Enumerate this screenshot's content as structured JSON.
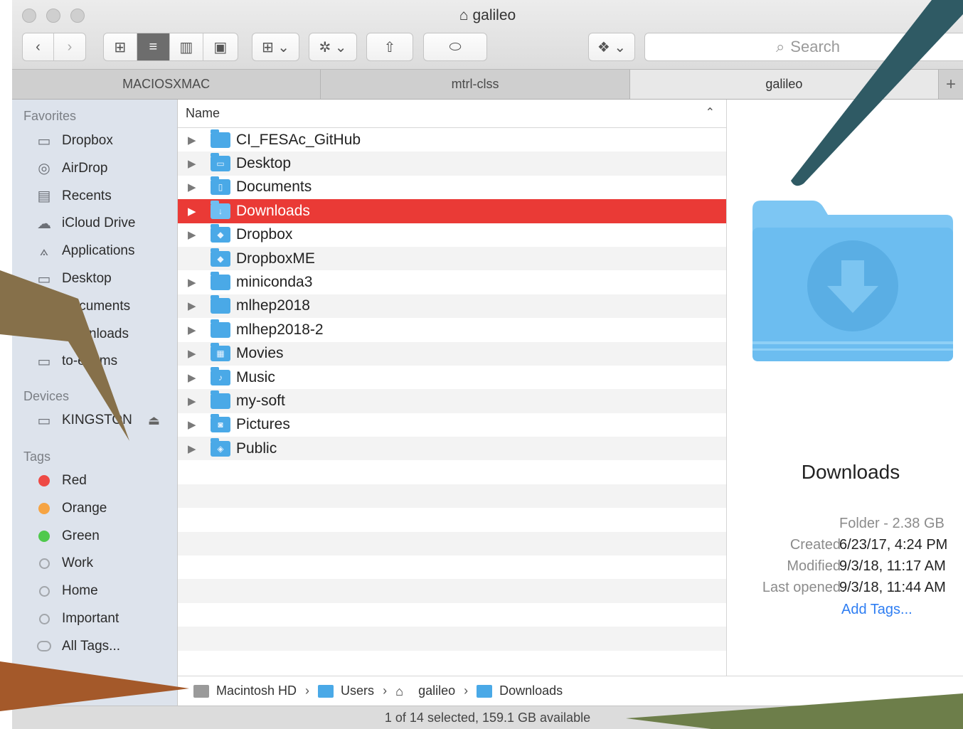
{
  "window": {
    "title": "galileo",
    "tabs": [
      "MACIOSXMAC",
      "mtrl-clss",
      "galileo"
    ],
    "active_tab": 2,
    "search_placeholder": "Search"
  },
  "sidebar": {
    "favorites_label": "Favorites",
    "favorites": [
      {
        "label": "Dropbox",
        "icon": "folder-icon"
      },
      {
        "label": "AirDrop",
        "icon": "airdrop-icon"
      },
      {
        "label": "Recents",
        "icon": "recents-icon"
      },
      {
        "label": "iCloud Drive",
        "icon": "cloud-icon"
      },
      {
        "label": "Applications",
        "icon": "applications-icon"
      },
      {
        "label": "Desktop",
        "icon": "desktop-icon"
      },
      {
        "label": "Documents",
        "icon": "documents-icon"
      },
      {
        "label": "Downloads",
        "icon": "downloads-icon"
      },
      {
        "label": "to-exams",
        "icon": "folder-icon"
      }
    ],
    "devices_label": "Devices",
    "devices": [
      {
        "label": "KINGSTON",
        "icon": "drive-icon"
      }
    ],
    "tags_label": "Tags",
    "tags": [
      {
        "label": "Red",
        "color": "#ee4a45"
      },
      {
        "label": "Orange",
        "color": "#f6a443"
      },
      {
        "label": "Green",
        "color": "#4fc94c"
      },
      {
        "label": "Work",
        "color": ""
      },
      {
        "label": "Home",
        "color": ""
      },
      {
        "label": "Important",
        "color": ""
      },
      {
        "label": "All Tags...",
        "color": "all"
      }
    ]
  },
  "list": {
    "column_header": "Name",
    "rows": [
      {
        "name": "CI_FESAc_GitHub",
        "expandable": true,
        "glyph": ""
      },
      {
        "name": "Desktop",
        "expandable": true,
        "glyph": "▭"
      },
      {
        "name": "Documents",
        "expandable": true,
        "glyph": "▯"
      },
      {
        "name": "Downloads",
        "expandable": true,
        "glyph": "↓"
      },
      {
        "name": "Dropbox",
        "expandable": true,
        "glyph": "◆"
      },
      {
        "name": "DropboxME",
        "expandable": false,
        "glyph": "◆"
      },
      {
        "name": "miniconda3",
        "expandable": true,
        "glyph": ""
      },
      {
        "name": "mlhep2018",
        "expandable": true,
        "glyph": ""
      },
      {
        "name": "mlhep2018-2",
        "expandable": true,
        "glyph": ""
      },
      {
        "name": "Movies",
        "expandable": true,
        "glyph": "▦"
      },
      {
        "name": "Music",
        "expandable": true,
        "glyph": "♪"
      },
      {
        "name": "my-soft",
        "expandable": true,
        "glyph": ""
      },
      {
        "name": "Pictures",
        "expandable": true,
        "glyph": "◙"
      },
      {
        "name": "Public",
        "expandable": true,
        "glyph": "◈"
      }
    ],
    "selected_index": 3
  },
  "preview": {
    "title": "Downloads",
    "kind": "Folder - 2.38 GB",
    "created_label": "Created",
    "created": "6/23/17, 4:24 PM",
    "modified_label": "Modified",
    "modified": "9/3/18, 11:17 AM",
    "opened_label": "Last opened",
    "opened": "9/3/18, 11:44 AM",
    "add_tags": "Add Tags..."
  },
  "pathbar": [
    {
      "label": "Macintosh HD",
      "icon": "hard-drive-icon"
    },
    {
      "label": "Users",
      "icon": "folder-icon"
    },
    {
      "label": "galileo",
      "icon": "home-icon"
    },
    {
      "label": "Downloads",
      "icon": "downloads-folder-icon"
    }
  ],
  "status": "1 of 14 selected, 159.1 GB available"
}
